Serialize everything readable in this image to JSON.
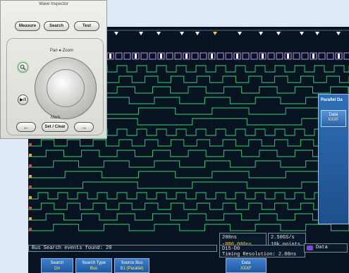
{
  "wave_inspector": {
    "title": "Wave Inspector",
    "measure_label": "Measure",
    "search_label": "Search",
    "test_label": "Test",
    "pan_zoom_label": "Pan ● Zoom",
    "mark_label": "Mark",
    "set_clear_label": "Set / Clear",
    "left_arrow": "←",
    "right_arrow": "→",
    "zoom_icon": "magnifier-icon",
    "play_pause_label": "▶/‖"
  },
  "scope": {
    "status_text": "Bus Search events found: 20",
    "timebase": "200ns",
    "trigger_position": "-880.000ns",
    "sample_rate": "2.50GS/s",
    "record_length": "10k points",
    "bus_channels": "D15-D0",
    "timing_resolution": "Timing Resolution: 2.00ns",
    "bus_label": "Data",
    "side_panel_title": "Parallel Da",
    "side_panel_item_label": "Data",
    "side_panel_item_value": "XXXF",
    "colors": {
      "digital": "#3dd17a",
      "bus": "#c8a6ff",
      "graticule": "#2a3a4c"
    }
  },
  "menu": [
    {
      "label": "Search",
      "value": "On"
    },
    {
      "label": "Search Type",
      "value": "Bus"
    },
    {
      "label": "Source Bus",
      "value": "B1 (Parallel)"
    },
    {
      "label": "Data",
      "value": "XXXF"
    }
  ]
}
